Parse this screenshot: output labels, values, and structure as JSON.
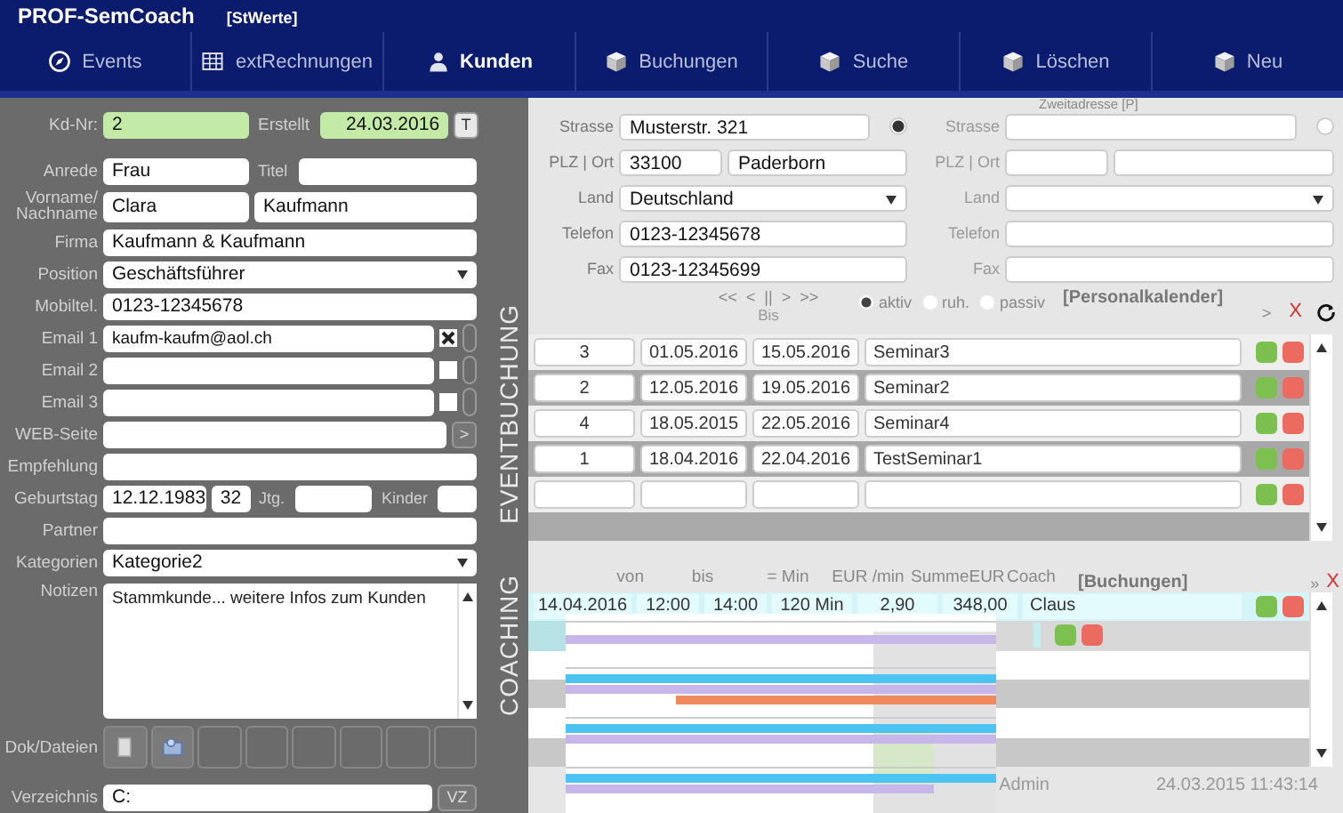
{
  "app": {
    "title": "PROF-SemCoach",
    "subtitle": "[StWerte]"
  },
  "nav": [
    {
      "label": "Events",
      "kind": "compass",
      "selected": false
    },
    {
      "label": "extRechnungen",
      "kind": "table",
      "selected": false
    },
    {
      "label": "Kunden",
      "kind": "person",
      "selected": true
    },
    {
      "label": "Buchungen",
      "kind": "box",
      "selected": false
    },
    {
      "label": "Suche",
      "kind": "box",
      "selected": false
    },
    {
      "label": "Löschen",
      "kind": "box",
      "selected": false
    },
    {
      "label": "Neu",
      "kind": "box",
      "selected": false
    }
  ],
  "form": [
    {
      "kind": "id",
      "label": "Kd-Nr:",
      "value": "2",
      "label2": "Erstellt",
      "value2": "24.03.2016",
      "button": "T"
    },
    {
      "kind": "pair",
      "label": "Anrede",
      "value": "Frau",
      "label2": "Titel"
    },
    {
      "kind": "name",
      "label": "Vorname/ Nachname",
      "value": "Clara",
      "value2": "Kaufmann"
    },
    {
      "kind": "text",
      "label": "Firma",
      "value": "Kaufmann & Kaufmann"
    },
    {
      "kind": "select",
      "label": "Position",
      "value": "Geschäftsführer"
    },
    {
      "kind": "text",
      "label": "Mobiltel.",
      "value": "0123-12345678"
    },
    {
      "kind": "email",
      "label": "Email 1",
      "value": "kaufm-kaufm@aol.ch",
      "checked": true,
      "on": false
    },
    {
      "kind": "email",
      "label": "Email 2",
      "checked": false,
      "on": false
    },
    {
      "kind": "email",
      "label": "Email 3",
      "checked": false,
      "on": false
    },
    {
      "kind": "link",
      "label": "WEB-Seite",
      "button": ">"
    },
    {
      "kind": "text",
      "label": "Empfehlung"
    },
    {
      "kind": "birthday",
      "label": "Geburtstag",
      "value": "12.12.1983",
      "value2": "32",
      "label2": "Jtg.",
      "label3": "Kinder"
    },
    {
      "kind": "text",
      "label": "Partner"
    },
    {
      "kind": "select",
      "label": "Kategorien",
      "value": "Kategorie2"
    },
    {
      "kind": "notes",
      "label": "Notizen",
      "value": "Stammkunde... weitere Infos zum Kunden"
    },
    {
      "kind": "files",
      "label": "Dok/Dateien"
    },
    {
      "kind": "dir",
      "label": "Verzeichnis",
      "value": "C:",
      "button": "VZ"
    }
  ],
  "addresses": [
    {
      "selected": true,
      "rows": [
        {
          "kind": "text",
          "label": "Strasse",
          "value": "Musterstr. 321"
        },
        {
          "kind": "split",
          "label": "PLZ | Ort",
          "value": "33100",
          "value2": "Paderborn"
        },
        {
          "kind": "select",
          "label": "Land",
          "value": "Deutschland"
        },
        {
          "kind": "text",
          "label": "Telefon",
          "value": "0123-12345678"
        },
        {
          "kind": "text",
          "label": "Fax",
          "value": "0123-12345699"
        }
      ]
    },
    {
      "heading": "Zweitadresse [P]",
      "selected": false,
      "rows": [
        {
          "kind": "text",
          "label": "Strasse"
        },
        {
          "kind": "split",
          "label": "PLZ | Ort"
        },
        {
          "kind": "select",
          "label": "Land"
        },
        {
          "kind": "text",
          "label": "Telefon"
        },
        {
          "kind": "text",
          "label": "Fax"
        }
      ]
    }
  ],
  "events": {
    "vertical_label": "EVENTBUCHUNG",
    "pager": "<<  <  ||  >  >>",
    "column_bis": "Bis",
    "title": "[Personalkalender]",
    "more": ">",
    "close": "X",
    "status": [
      {
        "label": "aktiv",
        "selected": true
      },
      {
        "label": "ruh.",
        "selected": false
      },
      {
        "label": "passiv",
        "selected": false
      }
    ],
    "rows": [
      {
        "nr": "3",
        "von": "01.05.2016",
        "bis": "15.05.2016",
        "name": "Seminar3"
      },
      {
        "nr": "2",
        "von": "12.05.2016",
        "bis": "19.05.2016",
        "name": "Seminar2"
      },
      {
        "nr": "4",
        "von": "18.05.2015",
        "bis": "22.05.2016",
        "name": "Seminar4"
      },
      {
        "nr": "1",
        "von": "18.04.2016",
        "bis": "22.04.2016",
        "name": "TestSeminar1"
      }
    ]
  },
  "coaching": {
    "vertical_label": "COACHING",
    "columns": [
      "von",
      "bis",
      "= Min",
      "EUR /min",
      "SummeEUR",
      "Coach"
    ],
    "title": "[Buchungen]",
    "more": "»",
    "close": "X",
    "rows": [
      {
        "date": "14.04.2016",
        "von": "12:00",
        "bis": "14:00",
        "min": "120 Min",
        "rate": "2,90",
        "sum": "348,00",
        "coach": "Claus"
      }
    ],
    "user": "Admin",
    "timestamp": "24.03.2015 11:43:14"
  }
}
